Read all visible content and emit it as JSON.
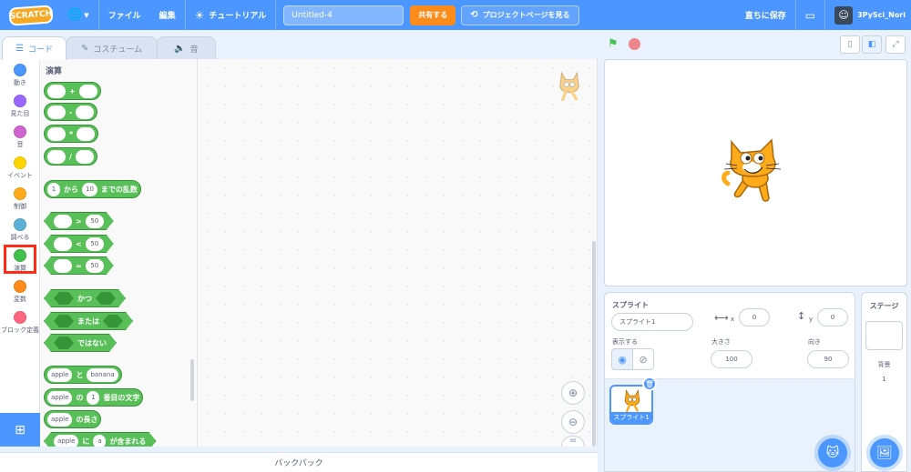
{
  "menubar": {
    "logo": "SCRATCH",
    "file": "ファイル",
    "edit": "編集",
    "tutorial": "チュートリアル",
    "project_title": "Untitled-4",
    "share": "共有する",
    "project_page": "プロジェクトページを見る",
    "save_now": "直ちに保存",
    "username": "3PySci_Nori"
  },
  "tabs": {
    "code": "コード",
    "costumes": "コスチューム",
    "sounds": "音"
  },
  "categories": [
    {
      "label": "動き",
      "color": "#4c97ff"
    },
    {
      "label": "見た目",
      "color": "#9966ff"
    },
    {
      "label": "音",
      "color": "#cf63cf"
    },
    {
      "label": "イベント",
      "color": "#ffd500"
    },
    {
      "label": "制御",
      "color": "#ffab19"
    },
    {
      "label": "調べる",
      "color": "#5cb1d6"
    },
    {
      "label": "演算",
      "color": "#40bf4a"
    },
    {
      "label": "変数",
      "color": "#ff8c1a"
    },
    {
      "label": "ブロック定義",
      "color": "#ff6680"
    }
  ],
  "palette": {
    "title": "演算",
    "add": "+",
    "sub": "-",
    "mul": "*",
    "div": "/",
    "random_from": "1",
    "random_kara": "から",
    "random_to": "10",
    "random_suffix": "までの乱数",
    "gt": ">",
    "lt": "<",
    "eq": "=",
    "cmp_value": "50",
    "and": "かつ",
    "or": "または",
    "not": "ではない",
    "join_a": "apple",
    "join_to": "と",
    "join_b": "banana",
    "letter_of_word": "apple",
    "letter_of_no": "の",
    "letter_of_index": "1",
    "letter_of_suffix": "番目の文字",
    "length_word": "apple",
    "length_suffix": "の長さ",
    "contains_word": "apple",
    "contains_ni": "に",
    "contains_letter": "a",
    "contains_suffix": "が含まれる"
  },
  "backpack": "バックパック",
  "sprite_info": {
    "label": "スプライト",
    "name": "スプライト1",
    "x_label": "x",
    "x": "0",
    "y_label": "y",
    "y": "0",
    "show_label": "表示する",
    "size_label": "大きさ",
    "size": "100",
    "direction_label": "向き",
    "direction": "90"
  },
  "sprite_thumb": {
    "name": "スプライト1"
  },
  "stage_panel": {
    "title": "ステージ",
    "backdrop_label": "背景",
    "backdrop_count": "1"
  }
}
